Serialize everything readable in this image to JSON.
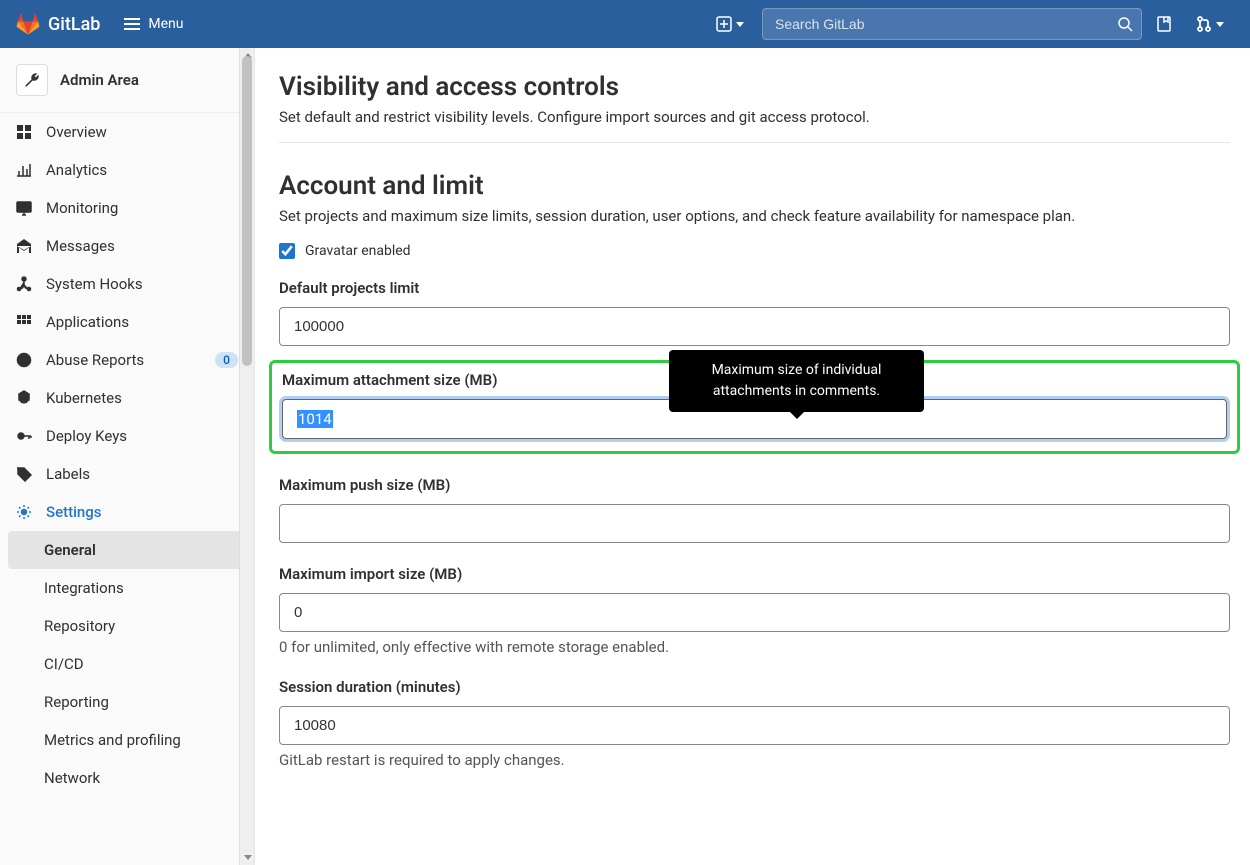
{
  "topbar": {
    "brand": "GitLab",
    "menu_label": "Menu",
    "search_placeholder": "Search GitLab"
  },
  "sidebar": {
    "title": "Admin Area",
    "items": [
      {
        "id": "overview",
        "label": "Overview",
        "icon": "overview"
      },
      {
        "id": "analytics",
        "label": "Analytics",
        "icon": "analytics"
      },
      {
        "id": "monitoring",
        "label": "Monitoring",
        "icon": "monitoring"
      },
      {
        "id": "messages",
        "label": "Messages",
        "icon": "messages"
      },
      {
        "id": "system-hooks",
        "label": "System Hooks",
        "icon": "hooks"
      },
      {
        "id": "applications",
        "label": "Applications",
        "icon": "applications"
      },
      {
        "id": "abuse-reports",
        "label": "Abuse Reports",
        "icon": "abuse",
        "badge": "0"
      },
      {
        "id": "kubernetes",
        "label": "Kubernetes",
        "icon": "kubernetes"
      },
      {
        "id": "deploy-keys",
        "label": "Deploy Keys",
        "icon": "key"
      },
      {
        "id": "labels",
        "label": "Labels",
        "icon": "labels"
      },
      {
        "id": "settings",
        "label": "Settings",
        "icon": "settings",
        "active": true
      }
    ],
    "sub_items": [
      {
        "id": "general",
        "label": "General",
        "active": true
      },
      {
        "id": "integrations",
        "label": "Integrations"
      },
      {
        "id": "repository",
        "label": "Repository"
      },
      {
        "id": "cicd",
        "label": "CI/CD"
      },
      {
        "id": "reporting",
        "label": "Reporting"
      },
      {
        "id": "metrics",
        "label": "Metrics and profiling"
      },
      {
        "id": "network",
        "label": "Network"
      }
    ]
  },
  "content": {
    "section1": {
      "title": "Visibility and access controls",
      "subtitle": "Set default and restrict visibility levels. Configure import sources and git access protocol."
    },
    "section2": {
      "title": "Account and limit",
      "subtitle": "Set projects and maximum size limits, session duration, user options, and check feature availability for namespace plan.",
      "gravatar_label": "Gravatar enabled",
      "gravatar_checked": true,
      "default_projects_label": "Default projects limit",
      "default_projects_value": "100000",
      "max_attachment_label": "Maximum attachment size (MB)",
      "max_attachment_value": "1014",
      "max_attachment_tooltip": "Maximum size of individual attachments in comments.",
      "max_push_label": "Maximum push size (MB)",
      "max_push_value": "",
      "max_import_label": "Maximum import size (MB)",
      "max_import_value": "0",
      "max_import_hint": "0 for unlimited, only effective with remote storage enabled.",
      "session_label": "Session duration (minutes)",
      "session_value": "10080",
      "session_hint": "GitLab restart is required to apply changes."
    }
  }
}
